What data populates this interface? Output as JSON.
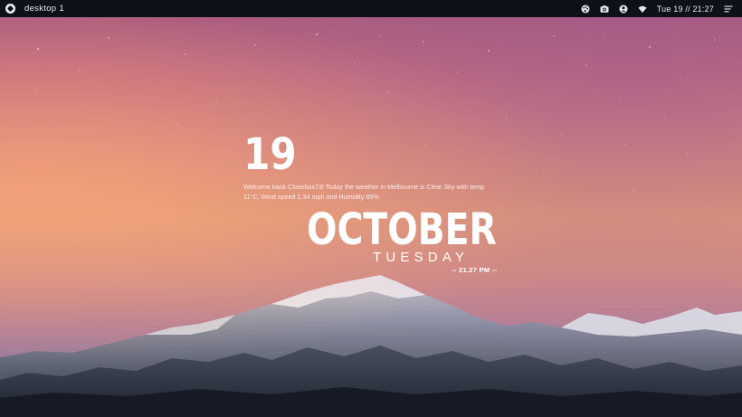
{
  "topbar": {
    "workspace_label": "desktop 1",
    "clock": "Tue 19 // 21:27",
    "icons": [
      "launcher-icon",
      "palette-icon",
      "camera-icon",
      "user-icon",
      "wifi-icon",
      "menu-icon"
    ]
  },
  "widget": {
    "day": "19",
    "welcome_text": "Welcome back Closebox73! Today the weather in Melbourne is Clear Sky with temp 11°C, Wind speed 1.34 mph and Humidity 85%",
    "month": "OCTOBER",
    "weekday": "TUESDAY",
    "time": "-- 21.27 PM --"
  },
  "colors": {
    "topbar_bg": "#0d121a",
    "topbar_text": "#e6e8ec",
    "widget_text": "#ffffff",
    "sky_top": "#a85a7d",
    "sky_horizon": "#e39b7a"
  }
}
